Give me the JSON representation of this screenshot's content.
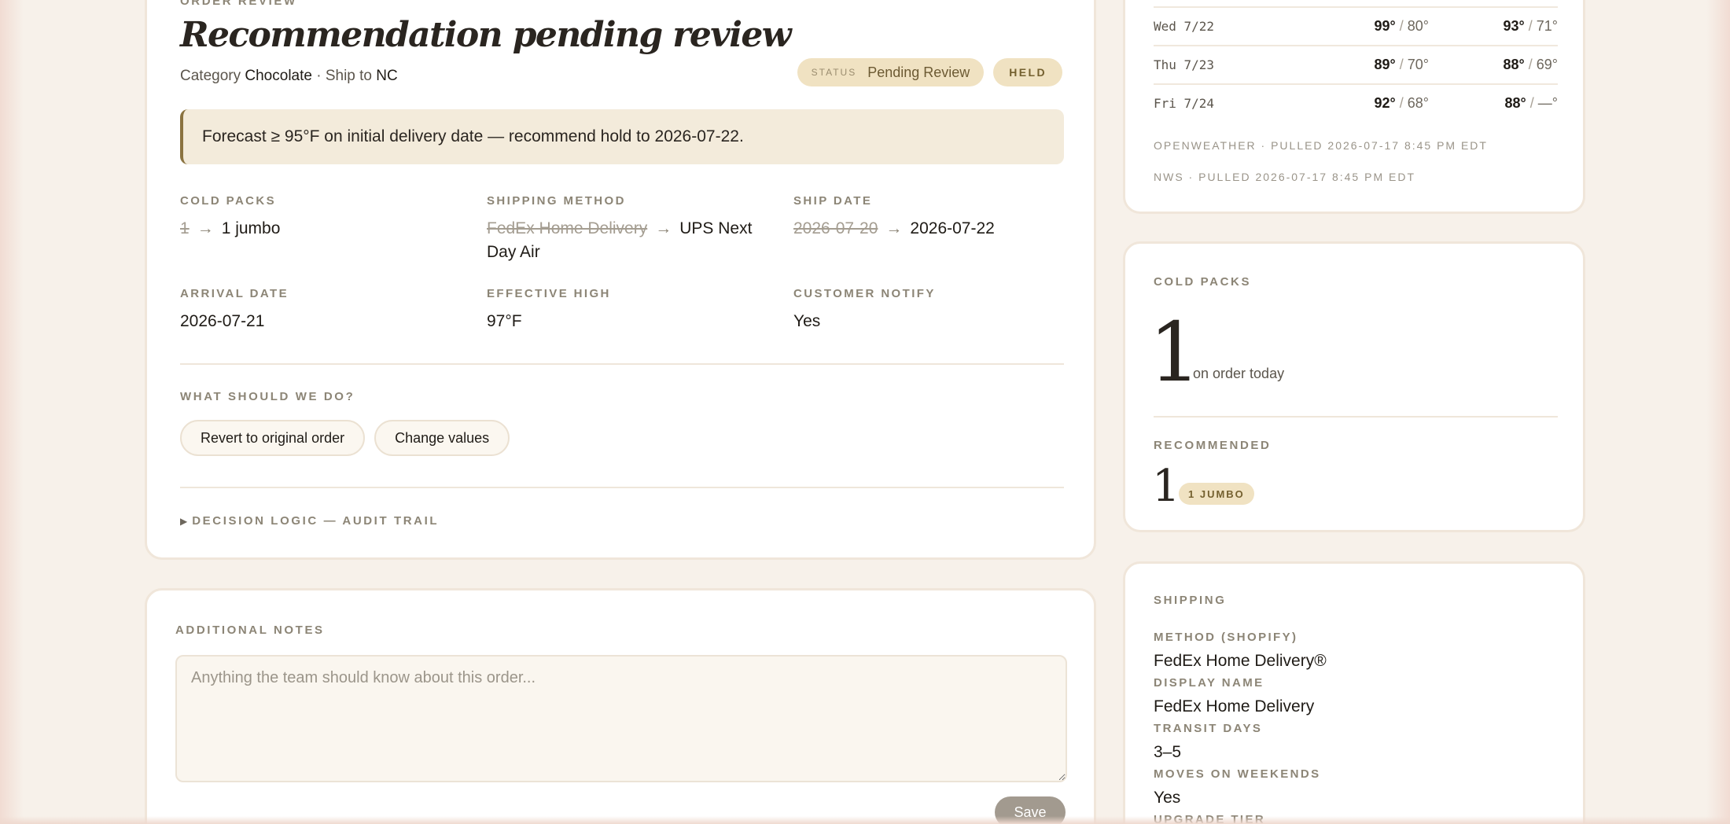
{
  "review": {
    "eyebrow": "ORDER REVIEW",
    "title": "Recommendation pending review",
    "category_label": "Category",
    "category_value": "Chocolate",
    "ship_to_label": "· Ship to",
    "ship_to_value": "NC",
    "status_key": "STATUS",
    "status_value": "Pending Review",
    "held_badge": "HELD",
    "forecast_message": "Forecast ≥ 95°F on initial delivery date — recommend hold to 2026-07-22.",
    "fields": {
      "cold_packs": {
        "label": "COLD PACKS",
        "old": "1",
        "new": "1 jumbo"
      },
      "shipping_method": {
        "label": "SHIPPING METHOD",
        "old": "FedEx Home Delivery",
        "new": "UPS Next Day Air"
      },
      "ship_date": {
        "label": "SHIP DATE",
        "old": "2026-07-20",
        "new": "2026-07-22"
      },
      "arrival_date": {
        "label": "ARRIVAL DATE",
        "value": "2026-07-21"
      },
      "effective_high": {
        "label": "EFFECTIVE HIGH",
        "value": "97°F"
      },
      "customer_notify": {
        "label": "CUSTOMER NOTIFY",
        "value": "Yes"
      }
    },
    "arrow": "→",
    "question": "WHAT SHOULD WE DO?",
    "actions": {
      "revert": "Revert to original order",
      "change": "Change values"
    },
    "audit_trail": "DECISION LOGIC — AUDIT TRAIL",
    "audit_toggle": "▶"
  },
  "notes": {
    "label": "ADDITIONAL NOTES",
    "value": "",
    "placeholder": "Anything the team should know about this order...",
    "save": "Save"
  },
  "weather": {
    "rows": [
      {
        "day": "Wed 7/22",
        "a_hi": "99°",
        "a_lo": "80°",
        "b_hi": "93°",
        "b_lo": "71°"
      },
      {
        "day": "Thu 7/23",
        "a_hi": "89°",
        "a_lo": "70°",
        "b_hi": "88°",
        "b_lo": "69°"
      },
      {
        "day": "Fri 7/24",
        "a_hi": "92°",
        "a_lo": "68°",
        "b_hi": "88°",
        "b_lo": "—°"
      }
    ],
    "slash": "/",
    "sources": [
      "OPENWEATHER · PULLED 2026-07-17 8:45 PM EDT",
      "NWS · PULLED 2026-07-17 8:45 PM EDT"
    ]
  },
  "cold_packs": {
    "label": "COLD PACKS",
    "on_order_count": "1",
    "on_order_text": "on order today",
    "recommended_label": "RECOMMENDED",
    "recommended_count": "1",
    "recommended_badge": "1 JUMBO"
  },
  "shipping": {
    "label": "SHIPPING",
    "method_label": "METHOD (SHOPIFY)",
    "method_value": "FedEx Home Delivery®",
    "display_name_label": "DISPLAY NAME",
    "display_name_value": "FedEx Home Delivery",
    "transit_label": "TRANSIT DAYS",
    "transit_value": "3–5",
    "weekends_label": "MOVES ON WEEKENDS",
    "weekends_value": "Yes",
    "upgrade_label": "UPGRADE TIER"
  },
  "colors": {
    "accent": "#8a7340",
    "badge_bg": "#f0e2c2",
    "page_bg": "#f7f1ea"
  }
}
